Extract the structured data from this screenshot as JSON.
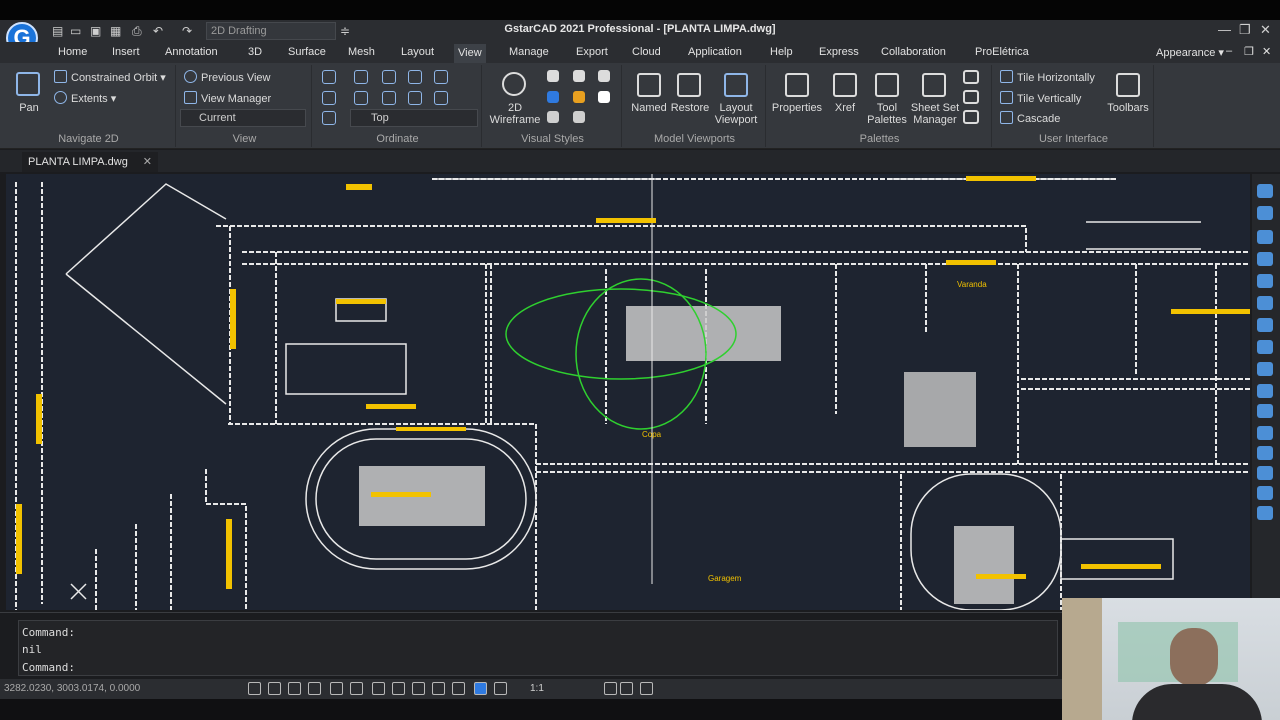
{
  "app": {
    "title": "GstarCAD 2021 Professional - [PLANTA LIMPA.dwg]",
    "logo_letter": "G",
    "workspace": "2D Drafting",
    "appearance": "Appearance",
    "accent": "#1a73d9"
  },
  "menu": [
    "Home",
    "Insert",
    "Annotation",
    "3D",
    "Surface",
    "Mesh",
    "Layout",
    "View",
    "Manage",
    "Export",
    "Cloud",
    "Application",
    "Help",
    "Express",
    "Collaboration",
    "ProElétrica"
  ],
  "menu_active": "View",
  "ribbon": {
    "navigate": {
      "pan": "Pan",
      "constrained_orbit": "Constrained Orbit",
      "extents": "Extents",
      "label": "Navigate 2D"
    },
    "view": {
      "previous": "Previous View",
      "manager": "View Manager",
      "current": "Current",
      "label": "View"
    },
    "ordinate": {
      "top": "Top",
      "label": "Ordinate"
    },
    "visual_styles": {
      "wireframe": "2D Wireframe",
      "label": "Visual Styles"
    },
    "model_viewports": {
      "named": "Named",
      "restore": "Restore",
      "layout_viewport": "Layout Viewport",
      "label": "Model Viewports"
    },
    "palettes": {
      "properties": "Properties",
      "xref": "Xref",
      "tool_palettes": "Tool Palettes",
      "sheet_set": "Sheet Set Manager",
      "label": "Palettes"
    },
    "ui": {
      "tile_h": "Tile Horizontally",
      "tile_v": "Tile Vertically",
      "cascade": "Cascade",
      "toolbars": "Toolbars",
      "label": "User Interface"
    }
  },
  "document_tab": "PLANTA LIMPA.dwg",
  "command": {
    "lines": [
      "Command:",
      "nil",
      "Command:"
    ]
  },
  "status": {
    "coordinates": "3282.0230, 3003.0174, 0.0000",
    "scale": "1:1"
  },
  "drawing_labels": [
    "Copa",
    "Varanda",
    "Garagem"
  ],
  "colors": {
    "canvas": "#1e2430",
    "lines": "#e8e8e8",
    "text": "#f2c200",
    "highlight": "#2fd02f"
  }
}
